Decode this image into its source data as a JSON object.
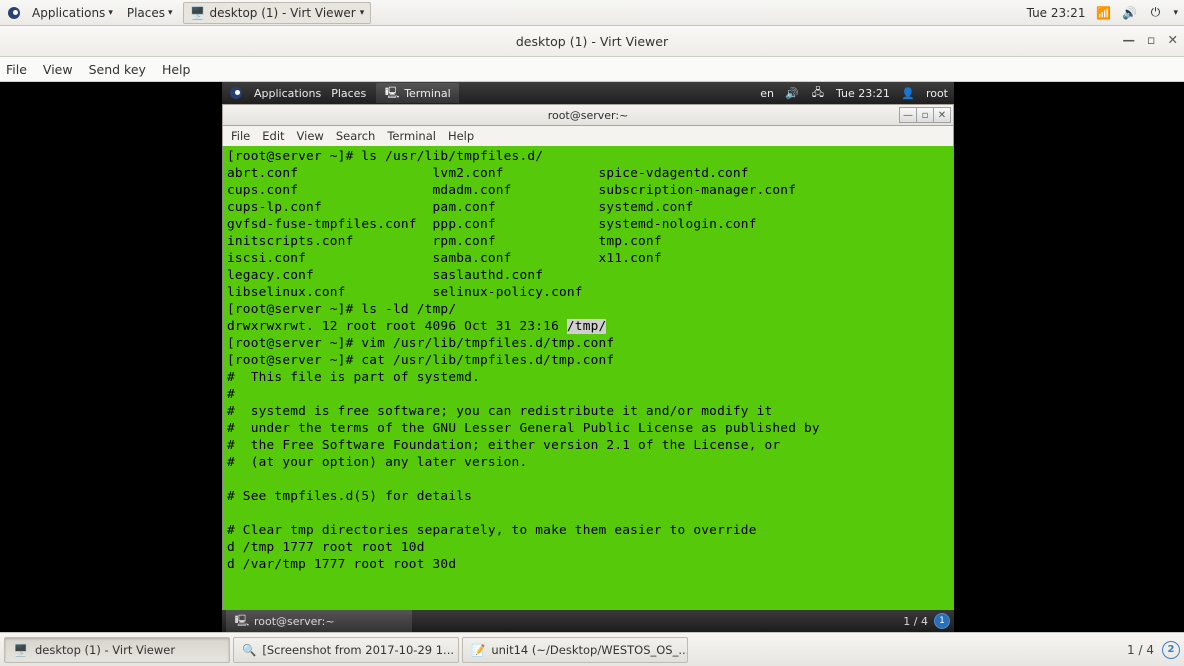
{
  "outer_panel": {
    "applications": "Applications",
    "places": "Places",
    "task_active": "desktop (1) - Virt Viewer",
    "clock": "Tue 23:21"
  },
  "virt_viewer": {
    "title": "desktop (1) - Virt Viewer",
    "menu": {
      "file": "File",
      "view": "View",
      "sendkey": "Send key",
      "help": "Help"
    }
  },
  "inner_panel": {
    "applications": "Applications",
    "places": "Places",
    "task": "Terminal",
    "lang": "en",
    "clock": "Tue 23:21",
    "user": "root"
  },
  "terminal": {
    "title": "root@server:~",
    "menu": {
      "file": "File",
      "edit": "Edit",
      "view": "View",
      "search": "Search",
      "terminal": "Terminal",
      "help": "Help"
    },
    "prompt1": "[root@server ~]# ",
    "cmd1": "ls /usr/lib/tmpfiles.d/",
    "ls_cols": [
      [
        "abrt.conf",
        "cups.conf",
        "cups-lp.conf",
        "gvfsd-fuse-tmpfiles.conf",
        "initscripts.conf",
        "iscsi.conf",
        "legacy.conf",
        "libselinux.conf"
      ],
      [
        "lvm2.conf",
        "mdadm.conf",
        "pam.conf",
        "ppp.conf",
        "rpm.conf",
        "samba.conf",
        "saslauthd.conf",
        "selinux-policy.conf"
      ],
      [
        "spice-vdagentd.conf",
        "subscription-manager.conf",
        "systemd.conf",
        "systemd-nologin.conf",
        "tmp.conf",
        "x11.conf",
        "",
        ""
      ]
    ],
    "prompt2": "[root@server ~]# ",
    "cmd2": "ls -ld /tmp/",
    "ls_ld_pre": "drwxrwxrwt. 12 root root 4096 Oct 31 23:16 ",
    "ls_ld_path": "/tmp/",
    "prompt3": "[root@server ~]# ",
    "cmd3": "vim /usr/lib/tmpfiles.d/tmp.conf",
    "prompt4": "[root@server ~]# ",
    "cmd4": "cat /usr/lib/tmpfiles.d/tmp.conf",
    "cat_lines": [
      "#  This file is part of systemd.",
      "#",
      "#  systemd is free software; you can redistribute it and/or modify it",
      "#  under the terms of the GNU Lesser General Public License as published by",
      "#  the Free Software Foundation; either version 2.1 of the License, or",
      "#  (at your option) any later version.",
      "",
      "# See tmpfiles.d(5) for details",
      "",
      "# Clear tmp directories separately, to make them easier to override",
      "d /tmp 1777 root root 10d",
      "d /var/tmp 1777 root root 30d"
    ]
  },
  "inner_bottom": {
    "task": "root@server:~",
    "ws": "1 / 4",
    "badge": "1"
  },
  "host_bottom": {
    "tasks": [
      "desktop (1) - Virt Viewer",
      "[Screenshot from 2017-10-29 1...",
      "unit14 (~/Desktop/WESTOS_OS_..."
    ],
    "ws": "1 / 4",
    "badge": "2"
  }
}
